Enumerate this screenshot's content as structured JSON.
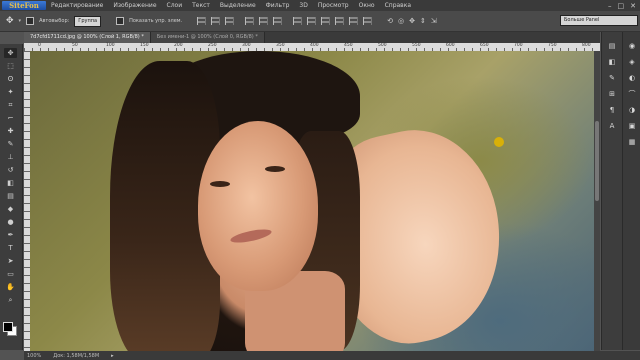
{
  "app": {
    "logo_text": "SiteFon",
    "menu": [
      "Редактирование",
      "Изображение",
      "Слои",
      "Текст",
      "Выделение",
      "Фильтр",
      "3D",
      "Просмотр",
      "Окно",
      "Справка"
    ],
    "window_controls": [
      "–",
      "□",
      "✕"
    ]
  },
  "options_bar": {
    "auto_select_label": "Автовыбор:",
    "auto_select_value": "Группа",
    "show_transform_label": "Показать упр. элем.",
    "workspace_value": "Больше Panel"
  },
  "tabs": [
    {
      "label": "7d7cfd1711cd.jpg @ 100% (Слой 1, RGB/8) *",
      "active": true
    },
    {
      "label": "Без имени-1 @ 100% (Слой 0, RGB/8) *",
      "active": false
    }
  ],
  "ruler_ticks": [
    "0",
    "50",
    "100",
    "150",
    "200",
    "250",
    "300",
    "350",
    "400",
    "450",
    "500",
    "550",
    "600",
    "650",
    "700",
    "750",
    "800"
  ],
  "tools": [
    {
      "icon": "move-icon",
      "glyph": "✥"
    },
    {
      "icon": "marquee-icon",
      "glyph": "⬚"
    },
    {
      "icon": "lasso-icon",
      "glyph": "ʘ"
    },
    {
      "icon": "magic-wand-icon",
      "glyph": "✦"
    },
    {
      "icon": "crop-icon",
      "glyph": "⌗"
    },
    {
      "icon": "eyedropper-icon",
      "glyph": "⌐"
    },
    {
      "icon": "healing-icon",
      "glyph": "✚"
    },
    {
      "icon": "brush-icon",
      "glyph": "✎"
    },
    {
      "icon": "stamp-icon",
      "glyph": "⊥"
    },
    {
      "icon": "history-brush-icon",
      "glyph": "↺"
    },
    {
      "icon": "eraser-icon",
      "glyph": "◧"
    },
    {
      "icon": "gradient-icon",
      "glyph": "▤"
    },
    {
      "icon": "blur-icon",
      "glyph": "◆"
    },
    {
      "icon": "dodge-icon",
      "glyph": "●"
    },
    {
      "icon": "pen-icon",
      "glyph": "✒"
    },
    {
      "icon": "type-icon",
      "glyph": "T"
    },
    {
      "icon": "path-select-icon",
      "glyph": "➤"
    },
    {
      "icon": "shape-icon",
      "glyph": "▭"
    },
    {
      "icon": "hand-icon",
      "glyph": "✋"
    },
    {
      "icon": "zoom-icon",
      "glyph": "⌕"
    }
  ],
  "status": {
    "zoom": "100%",
    "doc_size": "Док: 1,58М/1,58М"
  }
}
